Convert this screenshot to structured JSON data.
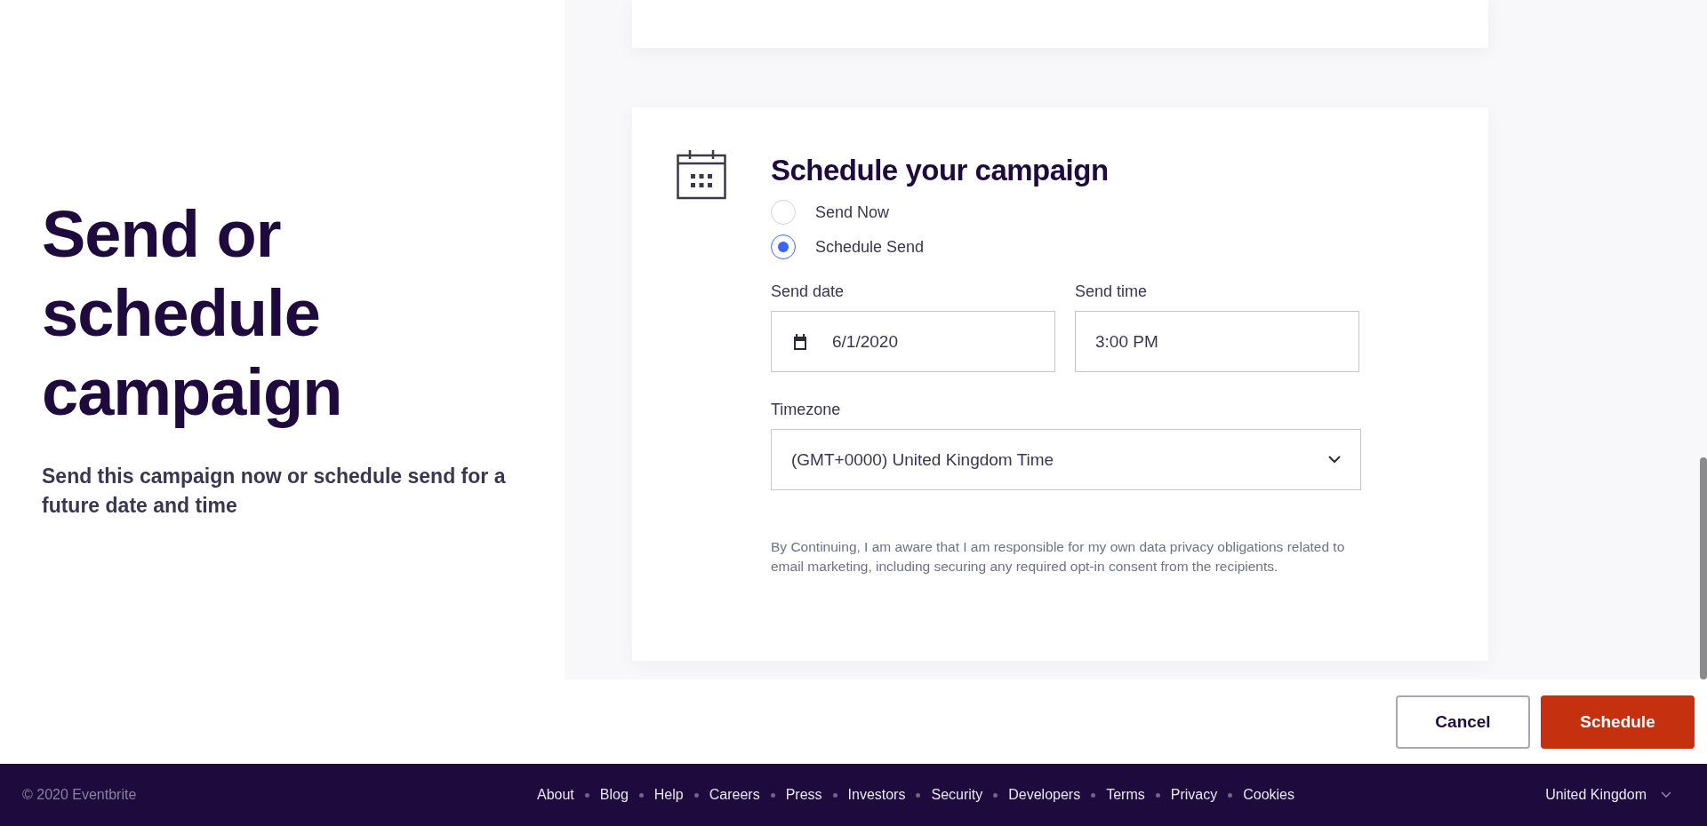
{
  "intro": {
    "title": "Send or schedule campaign",
    "subtitle": "Send this campaign now or schedule send for a future date and time"
  },
  "card": {
    "heading": "Schedule your campaign",
    "options": [
      {
        "label": "Send Now",
        "selected": false
      },
      {
        "label": "Schedule Send",
        "selected": true
      }
    ],
    "send_date": {
      "label": "Send date",
      "value": "6/1/2020"
    },
    "send_time": {
      "label": "Send time",
      "value": "3:00 PM"
    },
    "timezone": {
      "label": "Timezone",
      "value": "(GMT+0000) United Kingdom Time"
    },
    "disclaimer": "By Continuing, I am aware that I am responsible for my own data privacy obligations related to email marketing, including securing any required opt-in consent from the recipients."
  },
  "buttons": [
    {
      "label": "Cancel",
      "kind": "secondary"
    },
    {
      "label": "Schedule",
      "kind": "primary"
    }
  ],
  "footer": {
    "copyright": "© 2020 Eventbrite",
    "links": [
      "About",
      "Blog",
      "Help",
      "Careers",
      "Press",
      "Investors",
      "Security",
      "Developers",
      "Terms",
      "Privacy",
      "Cookies"
    ],
    "region": "United Kingdom"
  }
}
